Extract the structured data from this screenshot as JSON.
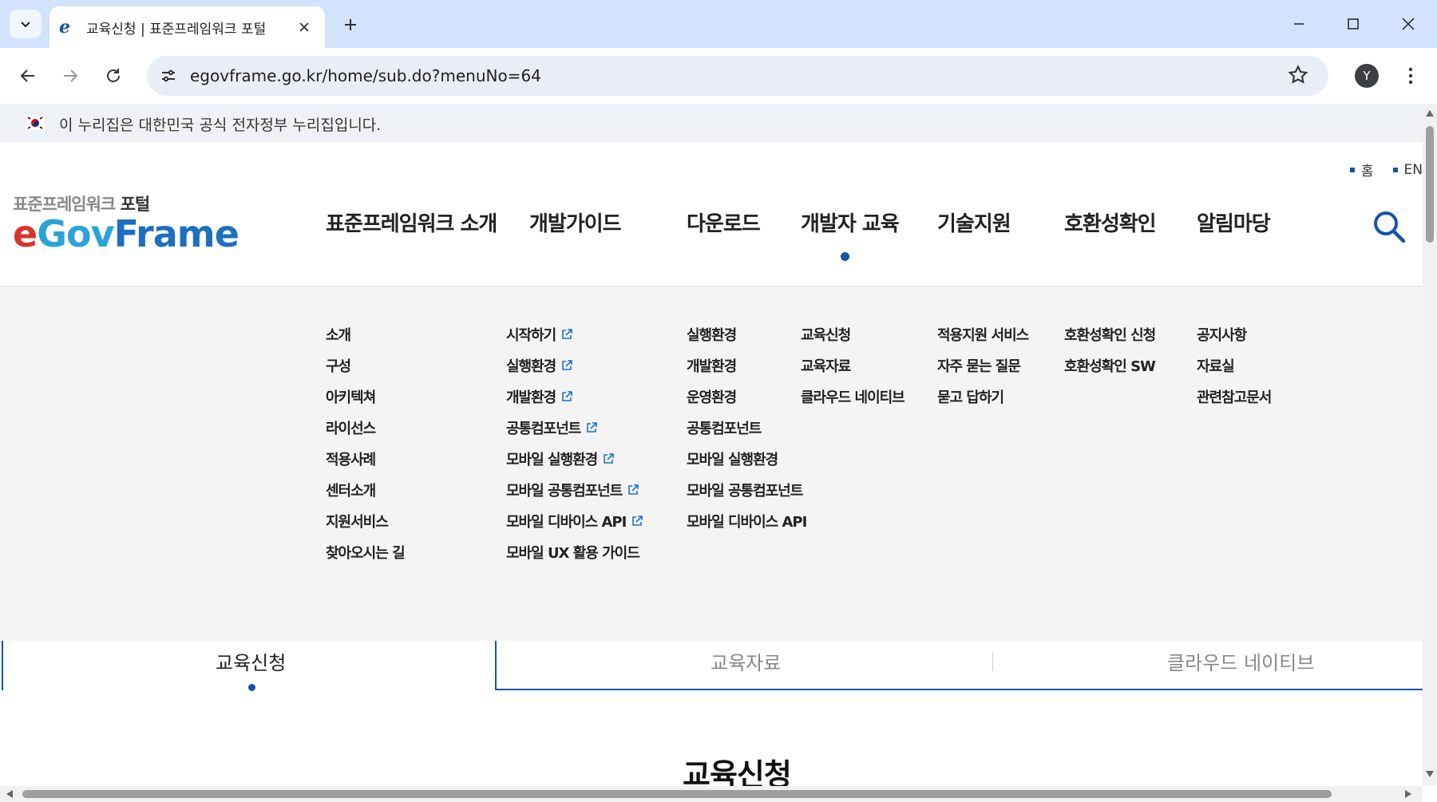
{
  "browser": {
    "tab_title": "교육신청 | 표준프레임워크 포털",
    "url": "egovframe.go.kr/home/sub.do?menuNo=64",
    "profile_initial": "Y"
  },
  "gov_banner": {
    "text": "이 누리집은 대한민국 공식 전자정부 누리집입니다."
  },
  "util_links": [
    {
      "label": "홈"
    },
    {
      "label": "EN"
    }
  ],
  "logo": {
    "sub_gray": "표준프레임워크",
    "sub_bold": "포털",
    "main_e": "e",
    "main_gov": "Gov",
    "main_frame": "Frame"
  },
  "gnb": [
    {
      "label": "표준프레임워크 소개"
    },
    {
      "label": "개발가이드"
    },
    {
      "label": "다운로드"
    },
    {
      "label": "개발자 교육"
    },
    {
      "label": "기술지원"
    },
    {
      "label": "호환성확인"
    },
    {
      "label": "알림마당"
    }
  ],
  "gnb_active": "개발자 교육",
  "mega": [
    {
      "items": [
        {
          "label": "소개"
        },
        {
          "label": "구성"
        },
        {
          "label": "아키텍쳐"
        },
        {
          "label": "라이선스"
        },
        {
          "label": "적용사례"
        },
        {
          "label": "센터소개"
        },
        {
          "label": "지원서비스"
        },
        {
          "label": "찾아오시는 길"
        }
      ]
    },
    {
      "items": [
        {
          "label": "시작하기",
          "external": true
        },
        {
          "label": "실행환경",
          "external": true
        },
        {
          "label": "개발환경",
          "external": true
        },
        {
          "label": "공통컴포넌트",
          "external": true
        },
        {
          "label": "모바일 실행환경",
          "external": true
        },
        {
          "label": "모바일 공통컴포넌트",
          "external": true
        },
        {
          "label": "모바일 디바이스 API",
          "external": true
        },
        {
          "label": "모바일 UX 활용 가이드"
        }
      ]
    },
    {
      "items": [
        {
          "label": "실행환경"
        },
        {
          "label": "개발환경"
        },
        {
          "label": "운영환경"
        },
        {
          "label": "공통컴포넌트"
        },
        {
          "label": "모바일 실행환경"
        },
        {
          "label": "모바일 공통컴포넌트"
        },
        {
          "label": "모바일 디바이스 API"
        }
      ]
    },
    {
      "items": [
        {
          "label": "교육신청"
        },
        {
          "label": "교육자료"
        },
        {
          "label": "클라우드 네이티브"
        }
      ]
    },
    {
      "items": [
        {
          "label": "적용지원 서비스"
        },
        {
          "label": "자주 묻는 질문"
        },
        {
          "label": "묻고 답하기"
        }
      ]
    },
    {
      "items": [
        {
          "label": "호환성확인 신청"
        },
        {
          "label": "호환성확인 SW"
        }
      ]
    },
    {
      "items": [
        {
          "label": "공지사항"
        },
        {
          "label": "자료실"
        },
        {
          "label": "관련참고문서"
        }
      ]
    }
  ],
  "subtabs": [
    {
      "label": "교육신청"
    },
    {
      "label": "교육자료"
    },
    {
      "label": "클라우드 네이티브"
    }
  ],
  "page_title": "교육신청",
  "colors": {
    "accent": "#1553a8",
    "chrome_tab_bar": "#d3e3fd",
    "mega_bg": "#f4f4f4"
  }
}
